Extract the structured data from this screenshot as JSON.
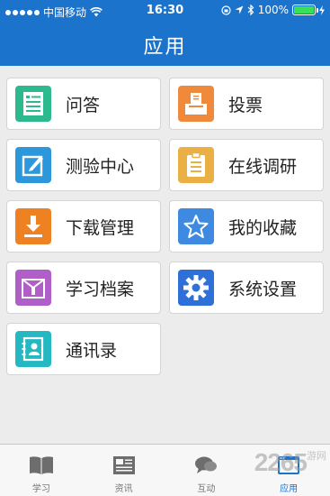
{
  "status_bar": {
    "carrier": "中国移动",
    "time": "16:30",
    "battery_text": "100%",
    "battery_level": 1.0,
    "icons": [
      "signal-dots-icon",
      "wifi-icon",
      "rotation-lock-icon",
      "location-icon",
      "bluetooth-icon",
      "battery-icon",
      "charging-icon"
    ]
  },
  "header": {
    "title": "应用"
  },
  "tiles": [
    {
      "label": "问答",
      "icon": "document-list-icon",
      "color": "#2db98e"
    },
    {
      "label": "投票",
      "icon": "ballot-box-icon",
      "color": "#ef8a3c"
    },
    {
      "label": "测验中心",
      "icon": "edit-pen-icon",
      "color": "#2d97dc"
    },
    {
      "label": "在线调研",
      "icon": "clipboard-icon",
      "color": "#eab044"
    },
    {
      "label": "下载管理",
      "icon": "download-icon",
      "color": "#ee8223"
    },
    {
      "label": "我的收藏",
      "icon": "star-icon",
      "color": "#3d8ae0"
    },
    {
      "label": "学习档案",
      "icon": "archive-folder-icon",
      "color": "#b05fc9"
    },
    {
      "label": "系统设置",
      "icon": "gear-icon",
      "color": "#2f6fd8"
    },
    {
      "label": "通讯录",
      "icon": "contacts-book-icon",
      "color": "#24b8c2"
    }
  ],
  "tabbar": {
    "tabs": [
      {
        "label": "学习",
        "icon": "book-icon",
        "active": false
      },
      {
        "label": "资讯",
        "icon": "newspaper-icon",
        "active": false
      },
      {
        "label": "互动",
        "icon": "chat-bubble-icon",
        "active": false
      },
      {
        "label": "应用",
        "icon": "apps-window-icon",
        "active": true
      }
    ],
    "active_color": "#1c73cc"
  },
  "watermark": {
    "text": "2265",
    "sub": "游网"
  }
}
